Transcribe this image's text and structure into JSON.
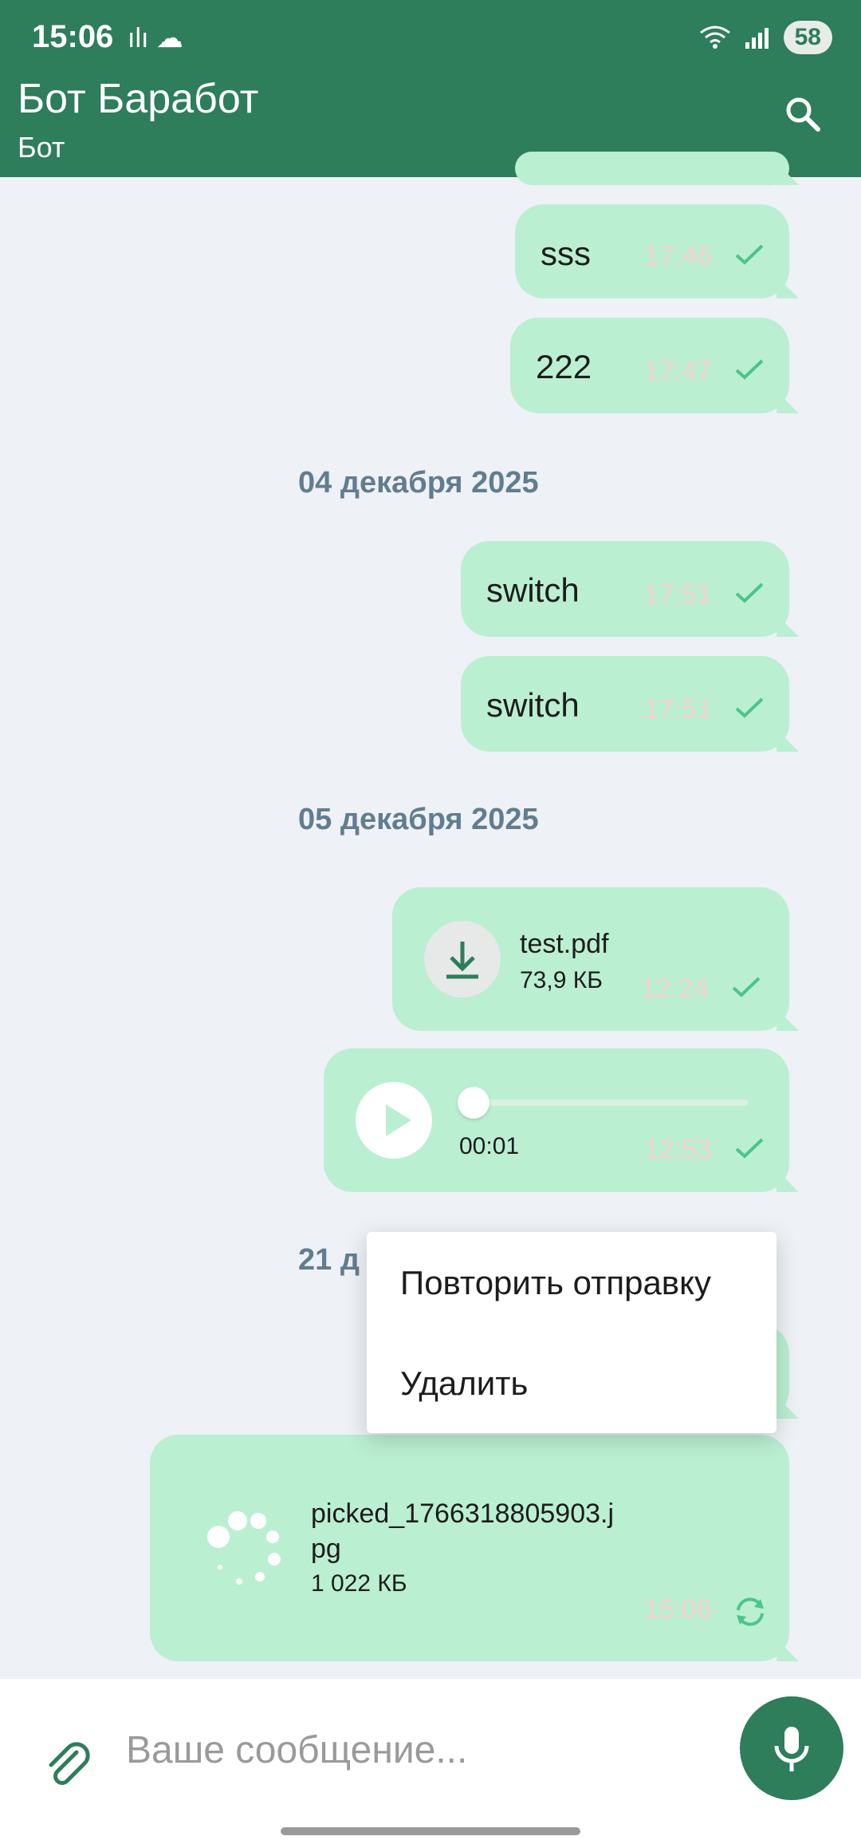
{
  "status": {
    "time": "15:06",
    "battery": "58"
  },
  "header": {
    "title": "Бот Баработ",
    "subtitle": "Бот"
  },
  "messages": [
    {
      "text": "sss",
      "time": "17:46"
    },
    {
      "text": "222",
      "time": "17:47"
    },
    {
      "text": "switch",
      "time": "17:51"
    },
    {
      "text": "switch",
      "time": "17:51"
    }
  ],
  "dates": {
    "d1": "04 декабря 2025",
    "d2": "05 декабря 2025",
    "d3_partial": "21 д"
  },
  "file_message": {
    "name": "test.pdf",
    "size": "73,9 КБ",
    "time": "12:24"
  },
  "audio_message": {
    "duration": "00:01",
    "time": "12:53"
  },
  "upload_message": {
    "name_line1": "picked_1766318805903.j",
    "name_line2": "pg",
    "size": "1 022 КБ",
    "time": "15:06"
  },
  "context_menu": {
    "items": [
      "Повторить отправку",
      "Удалить"
    ]
  },
  "composer": {
    "placeholder": "Ваше сообщение..."
  },
  "colors": {
    "header": "#2e7d5b",
    "bubble": "#bbefd2",
    "check": "#4cc48a",
    "date": "#617d8f"
  }
}
